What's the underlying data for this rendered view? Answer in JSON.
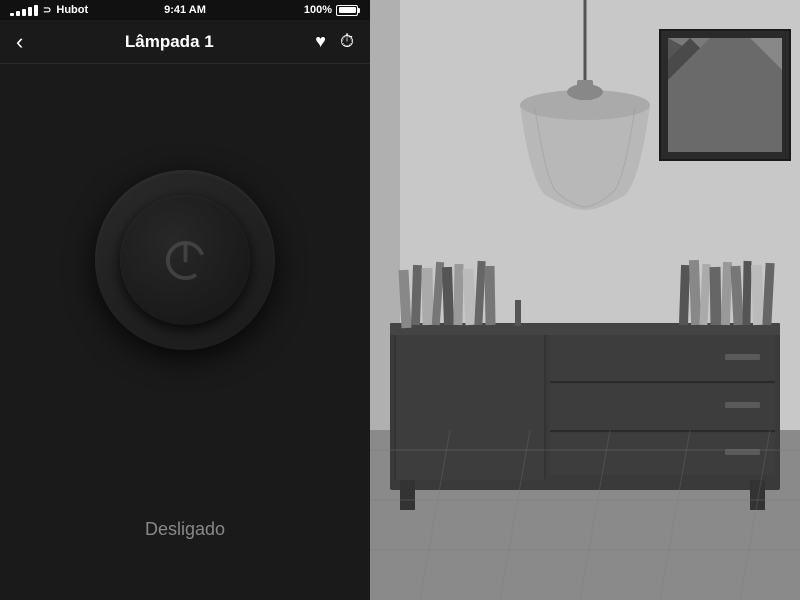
{
  "statusBar": {
    "carrier": "Hubot",
    "time": "9:41 AM",
    "battery": "100%"
  },
  "navBar": {
    "backLabel": "‹",
    "title": "Lâmpada 1",
    "favoriteIcon": "heart",
    "timerIcon": "clock"
  },
  "controls": {
    "powerLabel": "Desligado",
    "powerState": "off"
  }
}
